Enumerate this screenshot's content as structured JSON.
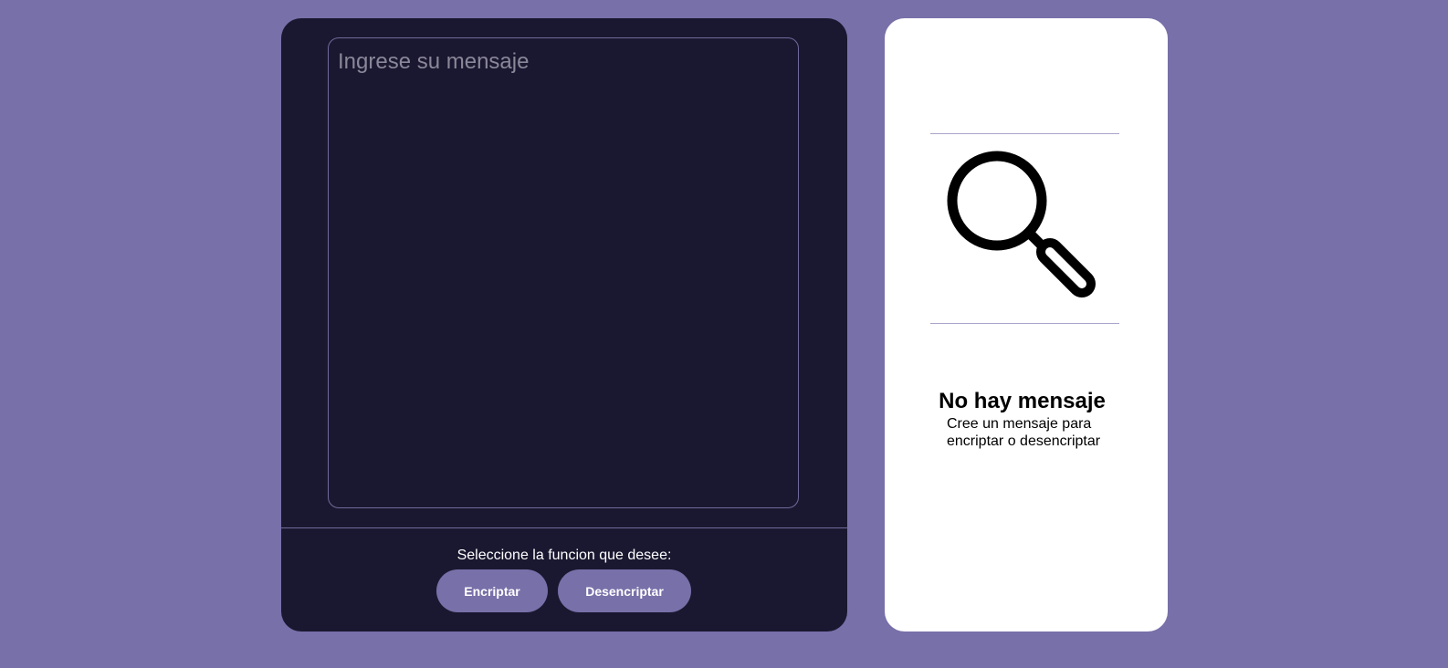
{
  "input": {
    "placeholder": "Ingrese su mensaje",
    "value": ""
  },
  "actions": {
    "prompt": "Seleccione la funcion que desee:",
    "encrypt_label": "Encriptar",
    "decrypt_label": "Desencriptar"
  },
  "output": {
    "icon": "magnifier-icon",
    "title": "No hay mensaje",
    "description_line1": "Cree un mensaje para",
    "description_line2": "encriptar o desencriptar"
  },
  "colors": {
    "background": "#7870a9",
    "panel_dark": "#1a1830",
    "accent": "#7870a9",
    "panel_light": "#ffffff"
  }
}
